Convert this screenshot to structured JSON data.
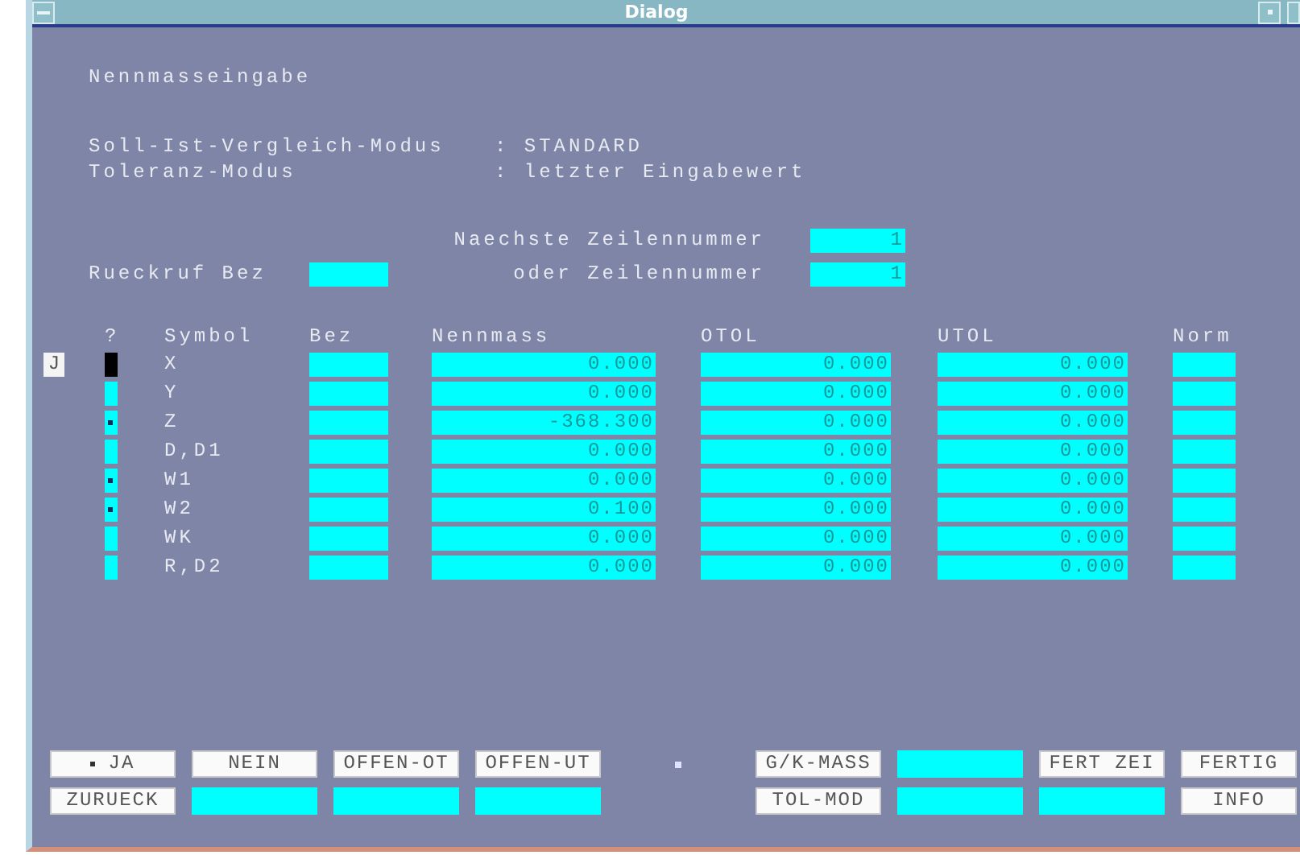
{
  "window": {
    "title": "Dialog"
  },
  "heading": "Nennmasseingabe",
  "modes": [
    {
      "label": "Soll-Ist-Vergleich-Modus",
      "value": ": STANDARD"
    },
    {
      "label": "Toleranz-Modus",
      "value": ": letzter Eingabewert"
    }
  ],
  "next_line": {
    "label": "Naechste Zeilennummer",
    "value": "1"
  },
  "recall": {
    "label": "Rueckruf Bez"
  },
  "line_number": {
    "label": "oder Zeilennummer",
    "value": "1"
  },
  "table": {
    "columns": [
      "?",
      "Symbol",
      "Bez",
      "Nennmass",
      "OTOL",
      "UTOL",
      "Norm"
    ],
    "cursor_label": "J",
    "rows": [
      {
        "symbol": "X",
        "selected": true,
        "flagged": false,
        "nennmass": "0.000",
        "otol": "0.000",
        "utol": "0.000"
      },
      {
        "symbol": "Y",
        "selected": false,
        "flagged": false,
        "nennmass": "0.000",
        "otol": "0.000",
        "utol": "0.000"
      },
      {
        "symbol": "Z",
        "selected": false,
        "flagged": true,
        "nennmass": "-368.300",
        "otol": "0.000",
        "utol": "0.000"
      },
      {
        "symbol": "D,D1",
        "selected": false,
        "flagged": false,
        "nennmass": "0.000",
        "otol": "0.000",
        "utol": "0.000"
      },
      {
        "symbol": "W1",
        "selected": false,
        "flagged": true,
        "nennmass": "0.000",
        "otol": "0.000",
        "utol": "0.000"
      },
      {
        "symbol": "W2",
        "selected": false,
        "flagged": true,
        "nennmass": "0.100",
        "otol": "0.000",
        "utol": "0.000"
      },
      {
        "symbol": "WK",
        "selected": false,
        "flagged": false,
        "nennmass": "0.000",
        "otol": "0.000",
        "utol": "0.000"
      },
      {
        "symbol": "R,D2",
        "selected": false,
        "flagged": false,
        "nennmass": "0.000",
        "otol": "0.000",
        "utol": "0.000"
      }
    ]
  },
  "softkeys": [
    [
      {
        "kind": "button",
        "label": "JA",
        "marked": true
      },
      {
        "kind": "button",
        "label": "NEIN",
        "marked": false
      },
      {
        "kind": "button",
        "label": "OFFEN-OT",
        "marked": false
      },
      {
        "kind": "button",
        "label": "OFFEN-UT",
        "marked": false
      },
      {
        "kind": "dot"
      },
      {
        "kind": "button",
        "label": "G/K-MASS",
        "marked": false
      },
      {
        "kind": "field"
      },
      {
        "kind": "button",
        "label": "FERT ZEI",
        "marked": false
      },
      {
        "kind": "button",
        "label": "FERTIG",
        "marked": false
      }
    ],
    [
      {
        "kind": "button",
        "label": "ZURUECK",
        "marked": false
      },
      {
        "kind": "field"
      },
      {
        "kind": "field"
      },
      {
        "kind": "field"
      },
      {
        "kind": "spacer"
      },
      {
        "kind": "button",
        "label": "TOL-MOD",
        "marked": false
      },
      {
        "kind": "field"
      },
      {
        "kind": "field"
      },
      {
        "kind": "button",
        "label": "INFO",
        "marked": false
      }
    ]
  ]
}
